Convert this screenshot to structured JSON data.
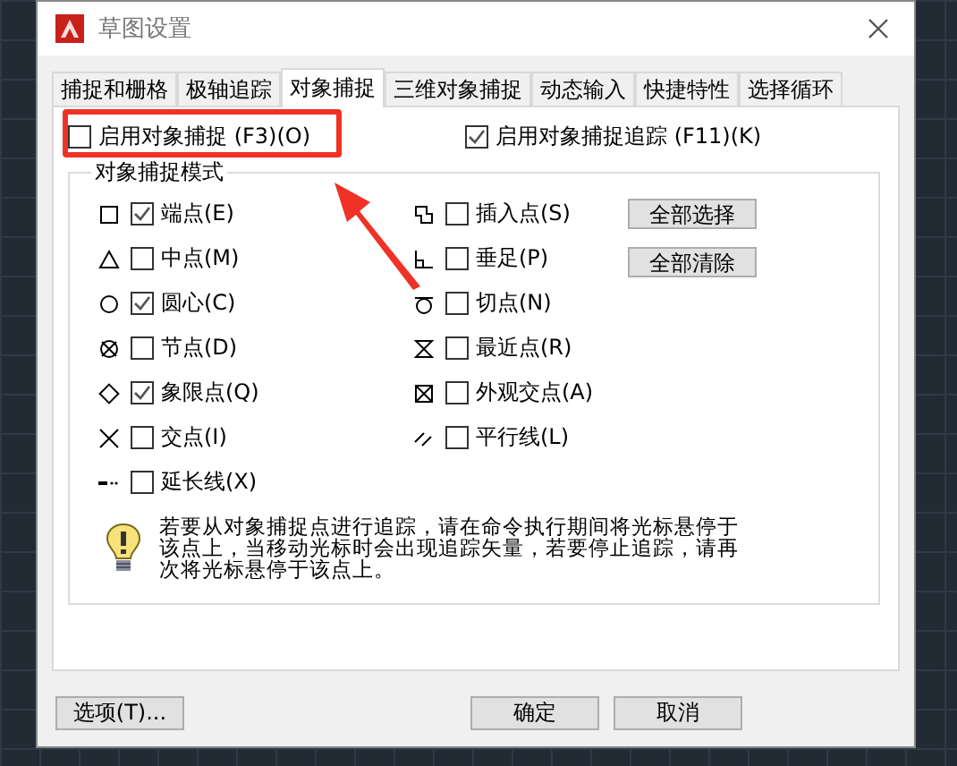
{
  "window": {
    "title": "草图设置"
  },
  "tabs": [
    {
      "label": "捕捉和栅格",
      "selected": false
    },
    {
      "label": "极轴追踪",
      "selected": false
    },
    {
      "label": "对象捕捉",
      "selected": true
    },
    {
      "label": "三维对象捕捉",
      "selected": false
    },
    {
      "label": "动态输入",
      "selected": false
    },
    {
      "label": "快捷特性",
      "selected": false
    },
    {
      "label": "选择循环",
      "selected": false
    }
  ],
  "top_options": [
    {
      "label": "启用对象捕捉 (F3)(O)",
      "checked": false
    },
    {
      "label": "启用对象捕捉追踪 (F11)(K)",
      "checked": true
    }
  ],
  "snap_group": {
    "title": "对象捕捉模式",
    "left_column": [
      {
        "label": "端点(E)",
        "checked": true
      },
      {
        "label": "中点(M)",
        "checked": false
      },
      {
        "label": "圆心(C)",
        "checked": true
      },
      {
        "label": "节点(D)",
        "checked": false
      },
      {
        "label": "象限点(Q)",
        "checked": true
      },
      {
        "label": "交点(I)",
        "checked": false
      },
      {
        "label": "延长线(X)",
        "checked": false
      }
    ],
    "right_column": [
      {
        "label": "插入点(S)",
        "checked": false
      },
      {
        "label": "垂足(P)",
        "checked": false
      },
      {
        "label": "切点(N)",
        "checked": false
      },
      {
        "label": "最近点(R)",
        "checked": false
      },
      {
        "label": "外观交点(A)",
        "checked": false
      },
      {
        "label": "平行线(L)",
        "checked": false
      }
    ],
    "buttons": [
      "全部选择",
      "全部清除"
    ]
  },
  "hint": "若要从对象捕捉点进行追踪，请在命令执行期间将光标悬停于该点上，当移动光标时会出现追踪矢量，若要停止追踪，请再次将光标悬停于该点上。",
  "footer_buttons": [
    "选项(T)...",
    "确定",
    "取消"
  ]
}
